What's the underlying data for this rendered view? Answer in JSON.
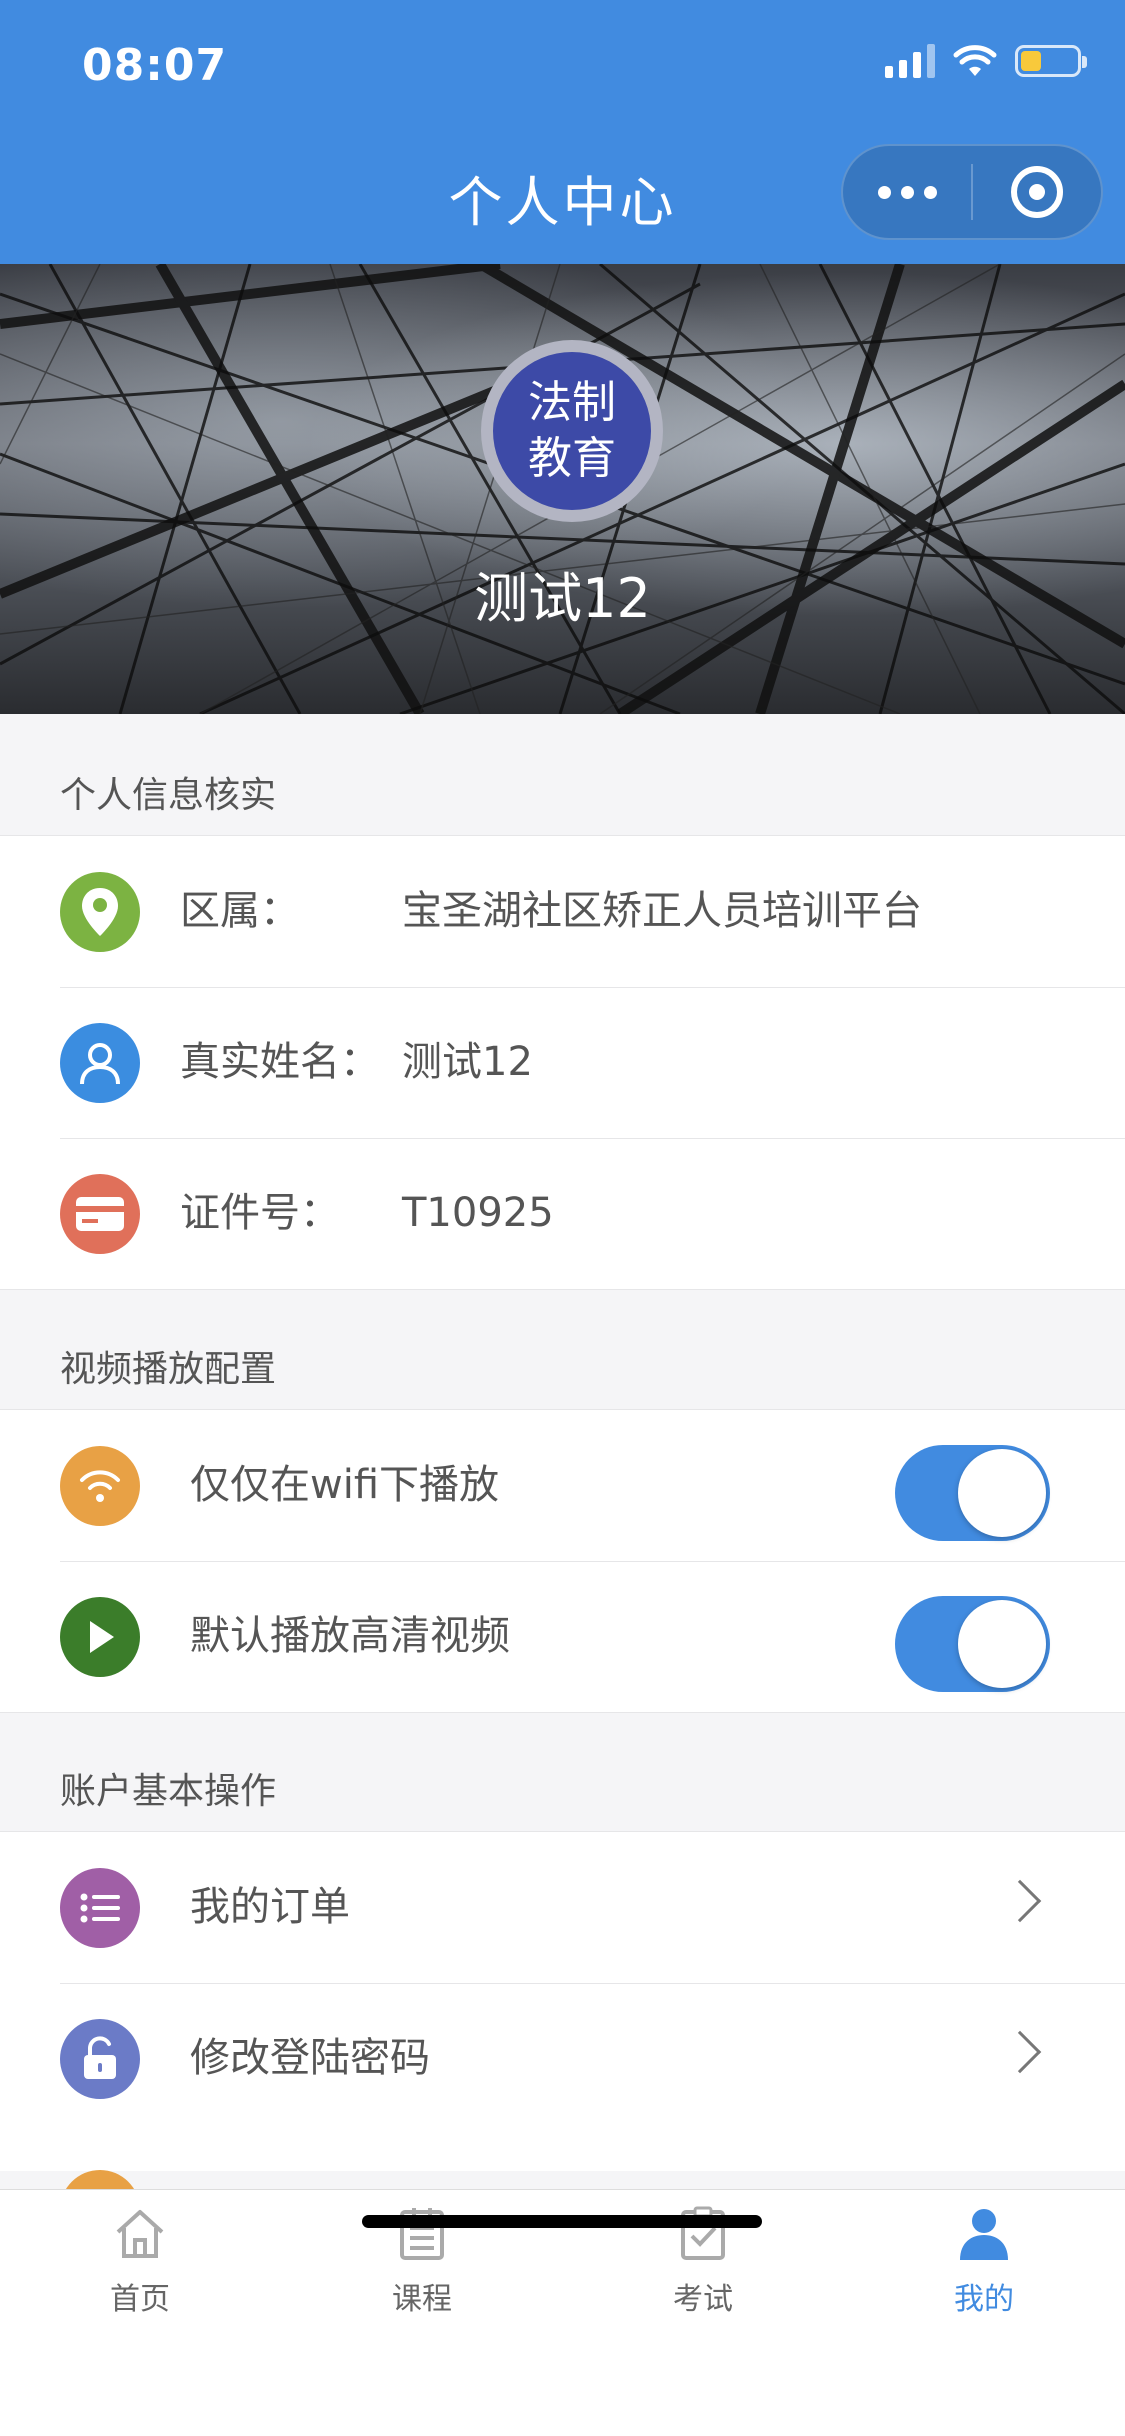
{
  "status_bar": {
    "time": "08:07"
  },
  "header": {
    "title": "个人中心"
  },
  "profile": {
    "avatar_text_line1": "法制",
    "avatar_text_line2": "教育",
    "name": "测试12"
  },
  "sections": {
    "info": {
      "title": "个人信息核实",
      "rows": [
        {
          "label": "区属：",
          "value": "宝圣湖社区矫正人员培训平台",
          "icon": "location-icon",
          "color": "#7cb342"
        },
        {
          "label": "真实姓名：",
          "value": "测试12",
          "icon": "user-icon",
          "color": "#3b8de0"
        },
        {
          "label": "证件号：",
          "value": "T10925",
          "icon": "id-card-icon",
          "color": "#e0705a"
        }
      ]
    },
    "video": {
      "title": "视频播放配置",
      "rows": [
        {
          "label": "仅仅在wifi下播放",
          "icon": "wifi-icon",
          "color": "#e8a145",
          "on": true
        },
        {
          "label": "默认播放高清视频",
          "icon": "play-icon",
          "color": "#3b7d2a",
          "on": true
        }
      ]
    },
    "account": {
      "title": "账户基本操作",
      "rows": [
        {
          "label": "我的订单",
          "icon": "list-icon",
          "color": "#a05fa6"
        },
        {
          "label": "修改登陆密码",
          "icon": "lock-icon",
          "color": "#6b7bc7"
        }
      ]
    }
  },
  "tabbar": {
    "items": [
      {
        "label": "首页",
        "icon": "home-icon",
        "active": false
      },
      {
        "label": "课程",
        "icon": "course-icon",
        "active": false
      },
      {
        "label": "考试",
        "icon": "exam-icon",
        "active": false
      },
      {
        "label": "我的",
        "icon": "profile-icon",
        "active": true
      }
    ],
    "active_color": "#418be0"
  },
  "colors": {
    "header_bg": "#418be0",
    "toggle_on": "#418be0"
  }
}
